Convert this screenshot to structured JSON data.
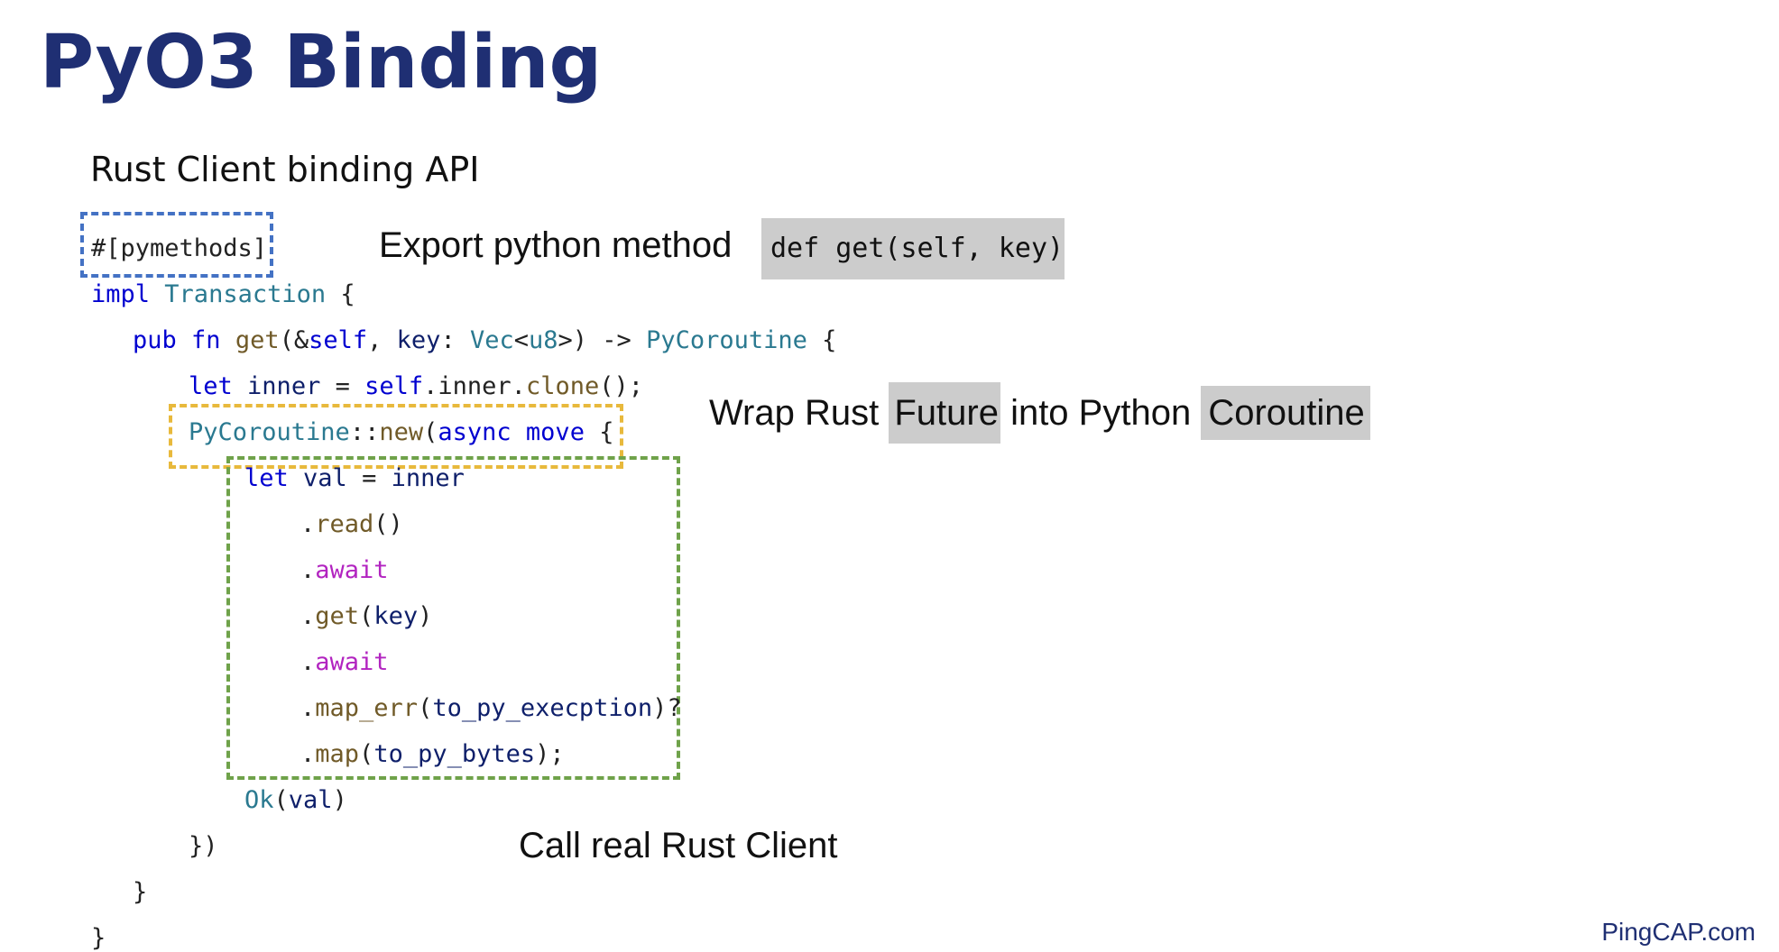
{
  "slide": {
    "title": "PyO3 Binding",
    "subtitle": "Rust Client binding API",
    "footer": "PingCAP.com"
  },
  "annotations": {
    "export_label": "Export python method",
    "export_code": "def get(self, key)",
    "wrap_prefix": "Wrap Rust",
    "wrap_future": "Future",
    "wrap_middle": "into Python",
    "wrap_coroutine": "Coroutine",
    "call_label": "Call real Rust Client"
  },
  "box_colors": {
    "pymethods": "#4472c4",
    "coroutine": "#e8b93c",
    "rust_client": "#6fa24a"
  },
  "code": {
    "line1": "#[pymethods]",
    "line2_kw": "impl",
    "line2_ty": "Transaction",
    "line2_rest": " {",
    "line3_kw1": "pub",
    "line3_kw2": "fn",
    "line3_fn": "get",
    "line3_p1": "(&",
    "line3_self": "self",
    "line3_p2": ", ",
    "line3_key": "key",
    "line3_p3": ": ",
    "line3_vec": "Vec",
    "line3_lt": "<",
    "line3_u8": "u8",
    "line3_p4": ">) -> ",
    "line3_ret": "PyCoroutine",
    "line3_p5": " {",
    "line4_kw": "let",
    "line4_id": "inner",
    "line4_p1": " = ",
    "line4_self": "self",
    "line4_p2": ".inner.",
    "line4_fn": "clone",
    "line4_p3": "();",
    "line5_ty": "PyCoroutine",
    "line5_p1": "::",
    "line5_fn": "new",
    "line5_p2": "(",
    "line5_kw1": "async",
    "line5_kw2": "move",
    "line5_p3": " {",
    "line6_kw": "let",
    "line6_id1": "val",
    "line6_p1": " = ",
    "line6_id2": "inner",
    "line7_fn": "read",
    "line7_p": "()",
    "line8_aw": "await",
    "line9_fn": "get",
    "line9_id": "key",
    "line10_aw": "await",
    "line11_fn": "map_err",
    "line11_id": "to_py_execption",
    "line11_p": ")?",
    "line12_fn": "map",
    "line12_id": "to_py_bytes",
    "line12_p": ");",
    "line13_ty": "Ok",
    "line13_id": "val",
    "line14": "})",
    "line15": "}",
    "line16": "}"
  }
}
